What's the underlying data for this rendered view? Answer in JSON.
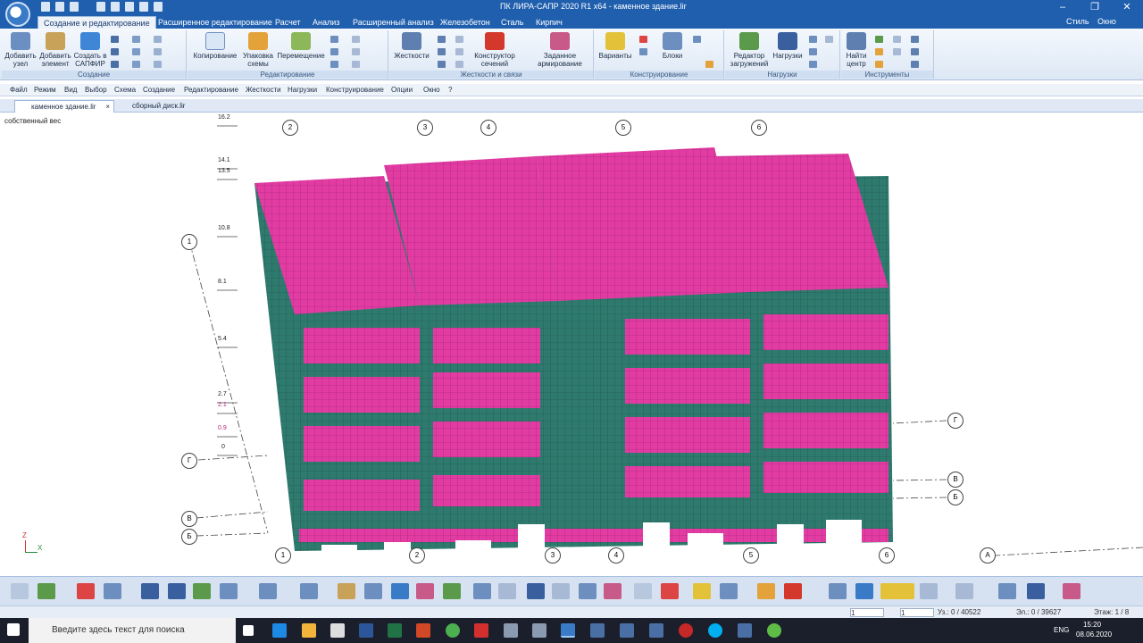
{
  "window": {
    "title": "ПК ЛИРА-САПР 2020 R1 x64 - каменное здание.lir",
    "style_label": "Стиль",
    "window_label": "Окно"
  },
  "ribbon_tabs": [
    {
      "label": "Создание и редактирование"
    },
    {
      "label": "Расширенное редактирование"
    },
    {
      "label": "Расчет"
    },
    {
      "label": "Анализ"
    },
    {
      "label": "Расширенный анализ"
    },
    {
      "label": "Железобетон"
    },
    {
      "label": "Сталь"
    },
    {
      "label": "Кирпич"
    }
  ],
  "ribbon_groups": {
    "create": {
      "label": "Создание",
      "add_node": "Добавить узел",
      "add_element": "Добавить элемент",
      "create_sapfir": "Создать в САПФИР"
    },
    "edit": {
      "label": "Редактирование",
      "copy": "Копирование",
      "pack": "Упаковка схемы",
      "move": "Перемещение"
    },
    "stiffness": {
      "label": "Жесткости и связи",
      "stiffness": "Жесткости",
      "section_builder": "Конструктор сечений",
      "reinforcement": "Заданное армирование"
    },
    "construct": {
      "label": "Конструирование",
      "variants": "Варианты",
      "blocks": "Блоки"
    },
    "loads": {
      "label": "Нагрузки",
      "load_editor": "Редактор загружений",
      "loads": "Нагрузки"
    },
    "tools": {
      "label": "Инструменты",
      "find_center": "Найти центр"
    }
  },
  "menu": [
    "Файл",
    "Режим",
    "Вид",
    "Выбор",
    "Схема",
    "Создание",
    "Редактирование",
    "Жесткости",
    "Нагрузки",
    "Конструирование",
    "Опции",
    "Окно",
    "?"
  ],
  "doc_tabs": [
    {
      "label": "каменное здание.lir",
      "close": "×"
    },
    {
      "label": "сборный диск.lir"
    }
  ],
  "viewport": {
    "load_case": "собственный вес",
    "levels": [
      "16.2",
      "14.1",
      "13.5",
      "10.8",
      "8.1",
      "5.4",
      "2.7",
      "2.1",
      "0.9",
      "0"
    ],
    "axes_top": [
      "2",
      "3",
      "4",
      "5",
      "6"
    ],
    "axes_bottom": [
      "1",
      "2",
      "3",
      "4",
      "5",
      "6"
    ],
    "axes_left": [
      "1",
      "Г",
      "В",
      "Б"
    ],
    "axes_right": [
      "Г",
      "В",
      "Б",
      "А"
    ],
    "triad": {
      "z": "Z",
      "x": "X"
    }
  },
  "status": {
    "nodes": "Уз.: 0 / 40522",
    "elements": "Эл.: 0 / 39627",
    "floor": "Этаж: 1 / 8",
    "step1": "1",
    "step2": "1"
  },
  "taskbar": {
    "search_placeholder": "Введите здесь текст для поиска",
    "lang": "ENG",
    "time": "15:20",
    "date": "08.06.2020"
  },
  "colors": {
    "title_blue": "#1f5fae",
    "plate_magenta": "#e23ca3",
    "wall_teal": "#2f7a6e",
    "taskbar": "#1b1f2b"
  }
}
